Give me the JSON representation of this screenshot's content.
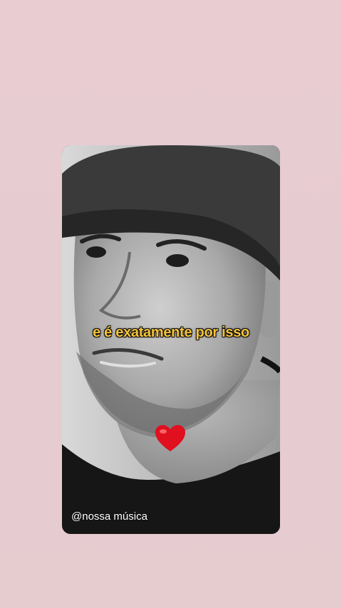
{
  "video": {
    "caption": "e é exatamente por isso",
    "watermark": "@nossa música",
    "emoji": "heart-icon"
  },
  "colors": {
    "background": "#e8ccd2",
    "caption": "#f5c33a",
    "heart": "#e0101e"
  }
}
